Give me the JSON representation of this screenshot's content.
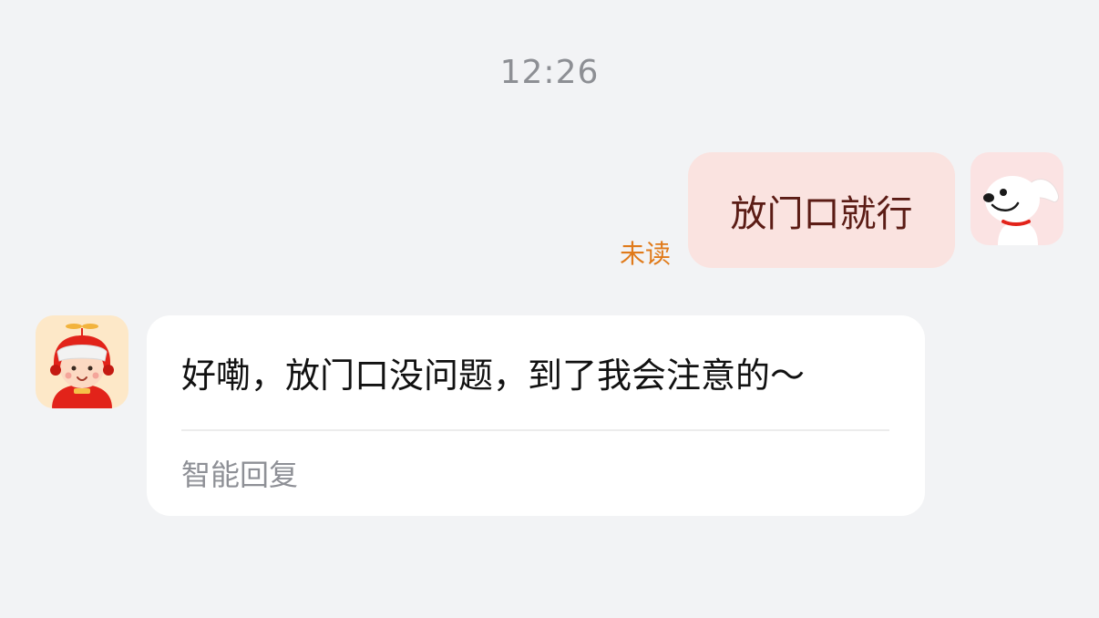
{
  "chat": {
    "timestamp": "12:26",
    "outgoing": {
      "text": "放门口就行",
      "status": "未读",
      "avatar_icon": "jd-dog-mascot-icon",
      "bubble_color": "#fae3e0",
      "status_color": "#e07a1a"
    },
    "incoming": {
      "text": "好嘞，放门口没问题，到了我会注意的～",
      "footer": "智能回复",
      "avatar_icon": "courier-avatar-icon"
    }
  }
}
